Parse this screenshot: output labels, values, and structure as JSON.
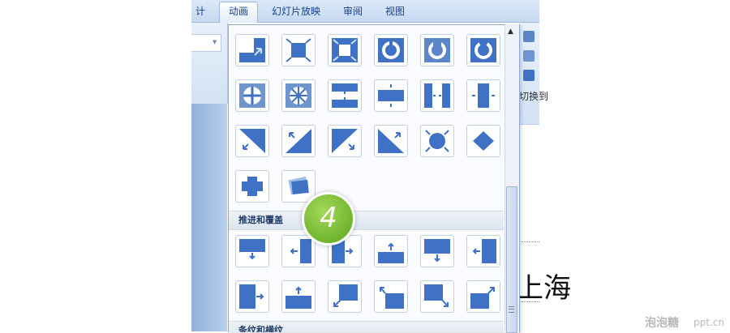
{
  "ribbon": {
    "tabs": [
      {
        "label": "设计",
        "visible_label": "计"
      },
      {
        "label": "动画",
        "active": true
      },
      {
        "label": "幻灯片放映"
      },
      {
        "label": "审阅"
      },
      {
        "label": "视图"
      }
    ],
    "right_partial_text": "切换到"
  },
  "gallery": {
    "sections": [
      {
        "title": "推进和覆盖"
      },
      {
        "title": "条纹和横纹"
      }
    ],
    "icons_row1": [
      "wipe-corner-icon",
      "box-in-icon",
      "box-out-icon",
      "wheel-1-icon",
      "wheel-2-icon",
      "wheel-3-icon"
    ],
    "icons_row2": [
      "wheel-4-icon",
      "wheel-8-icon",
      "split-horizontal-in-icon",
      "split-horizontal-out-icon",
      "split-vertical-in-icon",
      "split-vertical-out-icon"
    ],
    "icons_row3": [
      "diagonal-down-left-icon",
      "diagonal-up-left-icon",
      "diagonal-down-right-icon",
      "diagonal-up-right-icon",
      "circle-icon",
      "diamond-icon"
    ],
    "icons_row4": [
      "plus-icon",
      "newsflash-icon"
    ],
    "push_row1": [
      "cover-down-icon",
      "push-left-icon",
      "push-right-icon",
      "cover-up-icon",
      "push-down-icon",
      "cover-left-icon"
    ],
    "push_row2": [
      "cover-right-icon",
      "push-up-icon",
      "cover-down-left-icon",
      "cover-up-left-icon",
      "cover-down-right-icon",
      "cover-up-right-icon"
    ]
  },
  "step_badge": {
    "number": "4"
  },
  "slide": {
    "partial_text": "上海"
  },
  "watermark": {
    "brand": "泡泡糖",
    "site": "ppt.cn"
  },
  "colors": {
    "accent": "#3f72c4",
    "badge": "#7dc13a",
    "tab_bar": "#c6d9f1"
  }
}
